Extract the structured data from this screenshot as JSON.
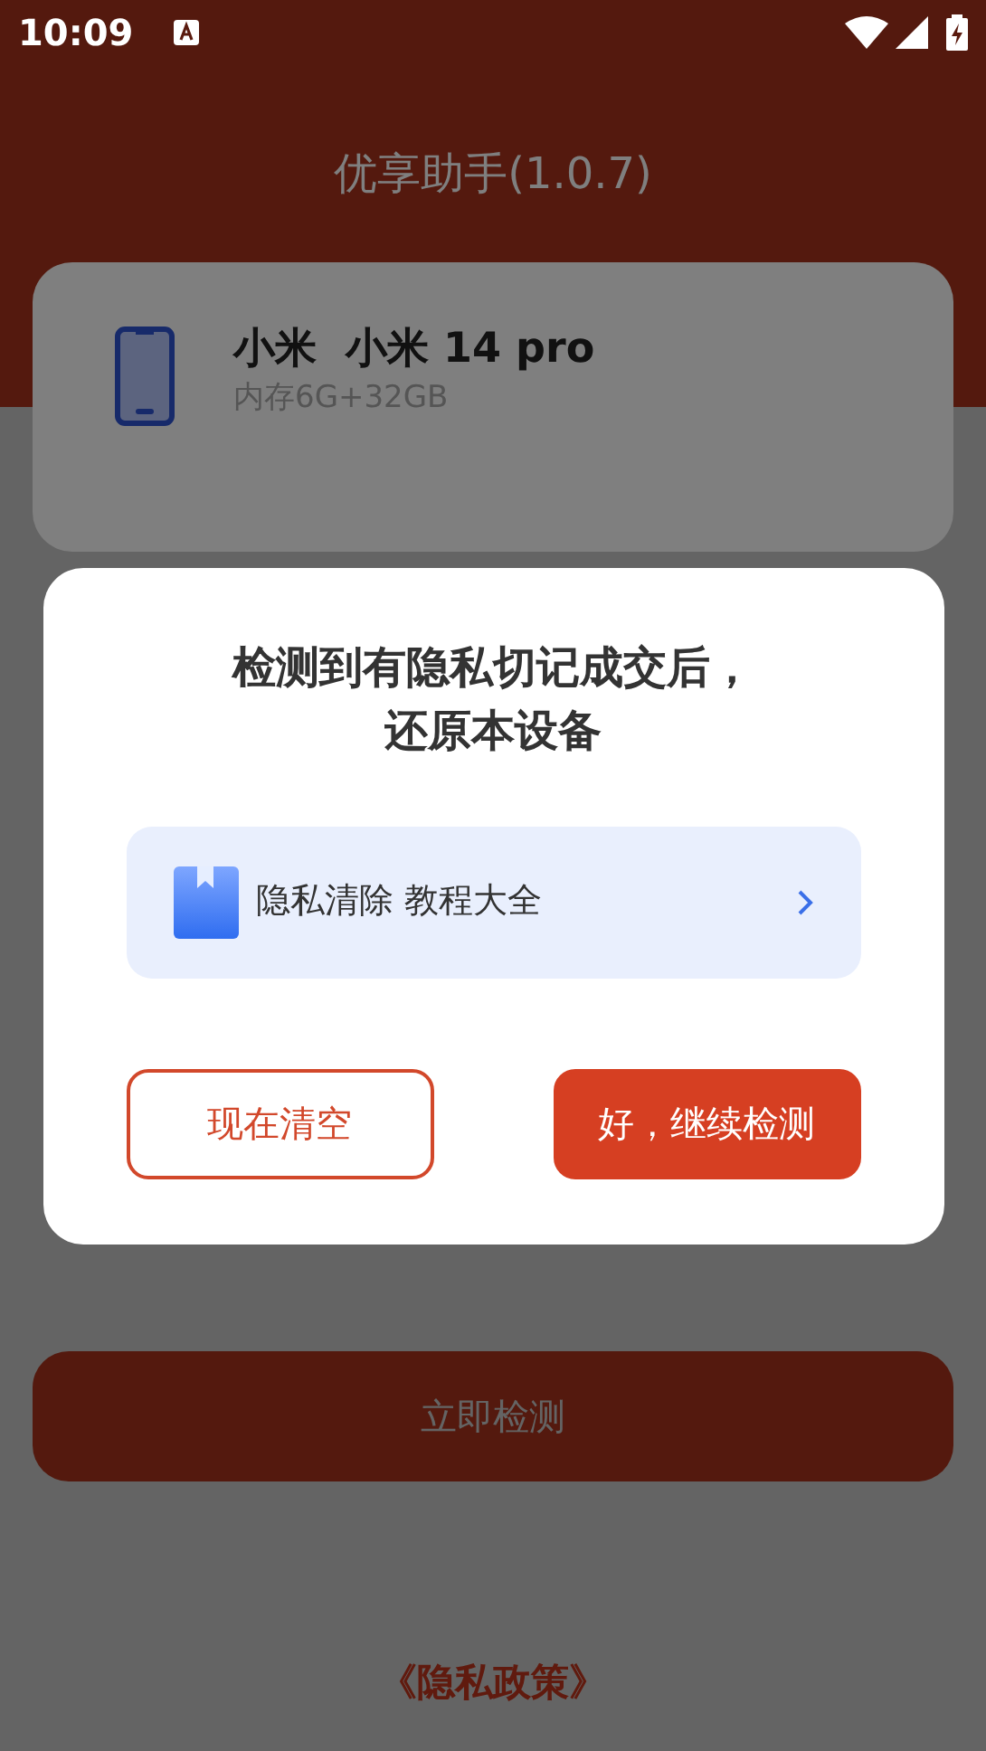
{
  "status_bar": {
    "time": "10:09"
  },
  "header": {
    "title": "优享助手(1.0.7)"
  },
  "device": {
    "name": "小米  小米 14 pro",
    "memory": "内存6G+32GB"
  },
  "detect_button": {
    "label": "立即检测"
  },
  "privacy_link": {
    "label": "《隐私政策》"
  },
  "dialog": {
    "title_lines": [
      "检测到有隐私切记成交后，",
      "还原本设备"
    ],
    "link": {
      "label": "隐私清除 教程大全"
    },
    "buttons": [
      {
        "label": "现在清空",
        "kind": "outline"
      },
      {
        "label": "好，继续检测",
        "kind": "filled"
      }
    ]
  }
}
